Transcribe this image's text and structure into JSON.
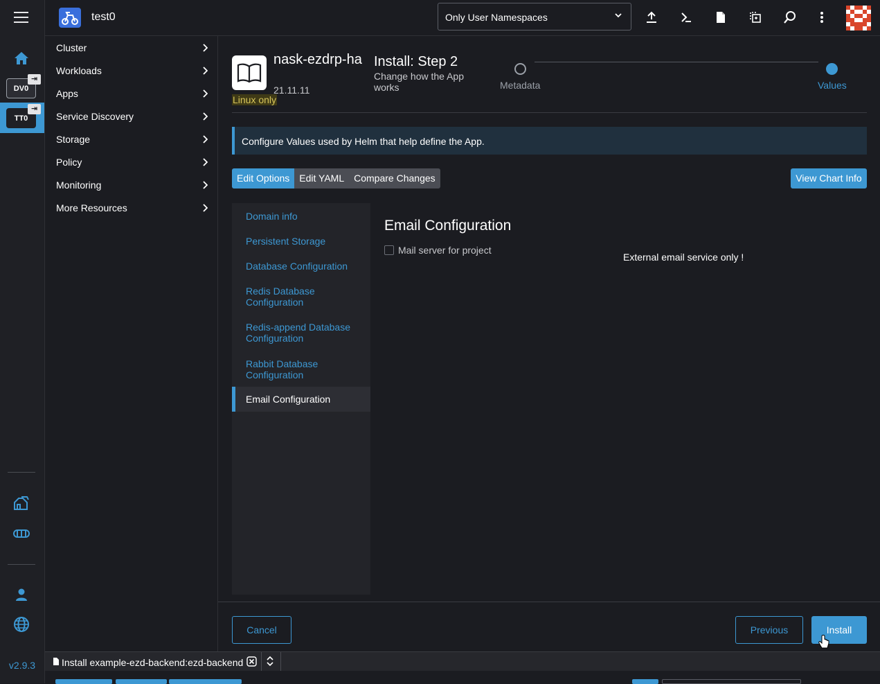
{
  "rail": {
    "clusters": [
      {
        "label": "DV0"
      },
      {
        "label": "TT0"
      }
    ],
    "version": "v2.9.3"
  },
  "header": {
    "cluster_name": "test0",
    "namespace_filter": "Only User Namespaces",
    "icons": [
      "upload-icon",
      "terminal-icon",
      "file-icon",
      "copy-config-icon",
      "search-icon",
      "more-icon"
    ]
  },
  "sidenav": {
    "items": [
      {
        "label": "Cluster"
      },
      {
        "label": "Workloads"
      },
      {
        "label": "Apps"
      },
      {
        "label": "Service Discovery"
      },
      {
        "label": "Storage"
      },
      {
        "label": "Policy"
      },
      {
        "label": "Monitoring"
      },
      {
        "label": "More Resources"
      }
    ]
  },
  "app": {
    "name": "nask-ezdrp-ha",
    "version": "21.11.11",
    "os_badge": "Linux only"
  },
  "wizard": {
    "title": "Install: Step 2",
    "subtitle": "Change how the App works",
    "steps": [
      {
        "label": "Metadata",
        "state": "done"
      },
      {
        "label": "Values",
        "state": "active"
      }
    ]
  },
  "banner": "Configure Values used by Helm that help define the App.",
  "tabs": [
    {
      "label": "Edit Options",
      "active": true
    },
    {
      "label": "Edit YAML",
      "active": false
    },
    {
      "label": "Compare Changes",
      "active": false
    }
  ],
  "view_chart_info": "View Chart Info",
  "sections": [
    {
      "label": "Domain info"
    },
    {
      "label": "Persistent Storage"
    },
    {
      "label": "Database Configuration"
    },
    {
      "label": "Redis Database Configuration"
    },
    {
      "label": "Redis-append Database Configuration"
    },
    {
      "label": "Rabbit Database Configuration"
    },
    {
      "label": "Email Configuration"
    }
  ],
  "email": {
    "title": "Email Configuration",
    "checkbox_label": "Mail server for project",
    "checkbox_checked": false,
    "note": "External email service only !"
  },
  "footer": {
    "cancel": "Cancel",
    "previous": "Previous",
    "install": "Install"
  },
  "bottom": {
    "tab_label": "Install example-ezd-backend:ezd-backend"
  },
  "colors": {
    "accent": "#3d98d3",
    "background": "#1b1c21",
    "badge": "#d7c55a"
  }
}
